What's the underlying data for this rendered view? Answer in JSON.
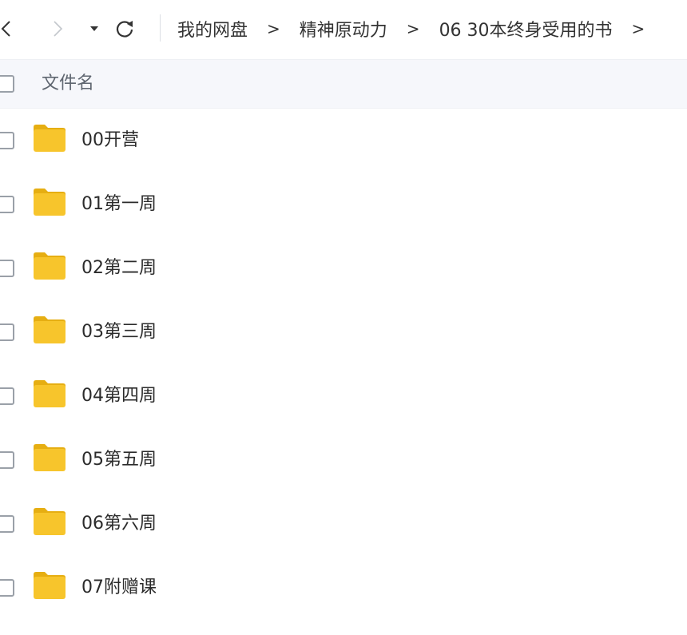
{
  "toolbar": {
    "back_icon": "chevron-left-icon",
    "forward_icon": "chevron-right-icon",
    "dropdown_icon": "caret-down-icon",
    "refresh_icon": "refresh-icon"
  },
  "breadcrumb": {
    "items": [
      "我的网盘",
      "精神原动力",
      "06 30本终身受用的书"
    ],
    "separator": ">"
  },
  "table": {
    "header_name": "文件名"
  },
  "files": [
    {
      "name": "00开营",
      "icon": "folder-icon"
    },
    {
      "name": "01第一周",
      "icon": "folder-icon"
    },
    {
      "name": "02第二周",
      "icon": "folder-icon"
    },
    {
      "name": "03第三周",
      "icon": "folder-icon"
    },
    {
      "name": "04第四周",
      "icon": "folder-icon"
    },
    {
      "name": "05第五周",
      "icon": "folder-icon"
    },
    {
      "name": "06第六周",
      "icon": "folder-icon"
    },
    {
      "name": "07附赠课",
      "icon": "folder-icon"
    }
  ],
  "colors": {
    "folder": "#f7c52c",
    "folder_tab": "#e6ae12",
    "header_bg": "#f6f7fb"
  }
}
